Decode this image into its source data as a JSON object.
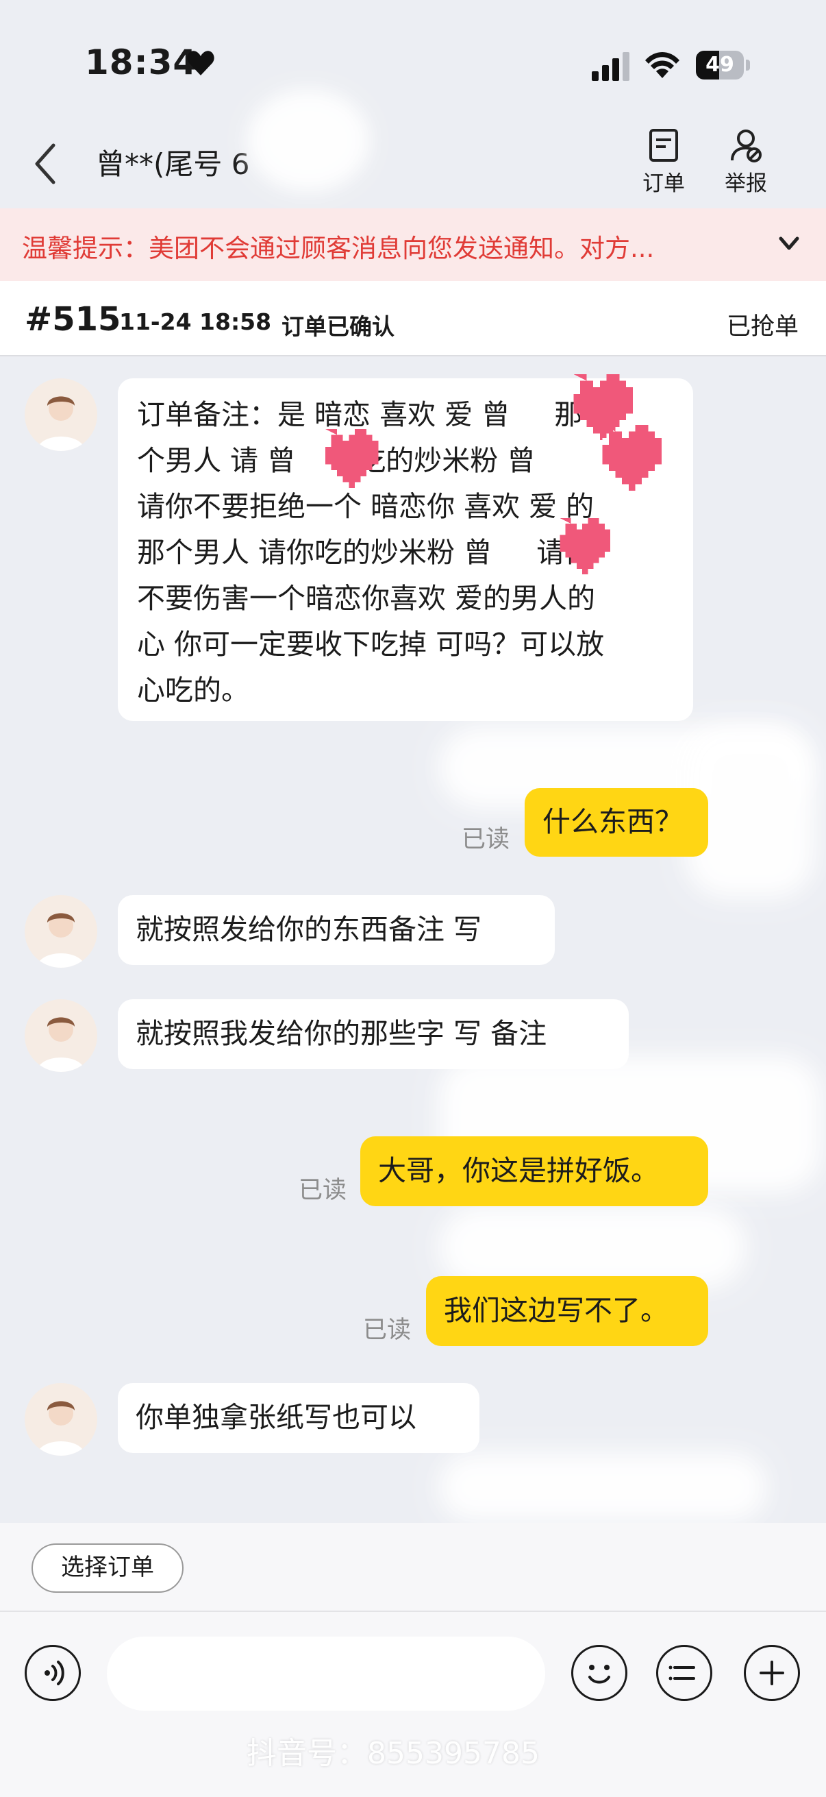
{
  "status_bar": {
    "time": "18:34",
    "battery": "49"
  },
  "nav": {
    "contact_name": "曾**(尾号 6",
    "order_label": "订单",
    "report_label": "举报"
  },
  "warning": {
    "text": "温馨提示：美团不会通过顾客消息向您发送通知。对方..."
  },
  "order": {
    "number": "#515",
    "time": "11-24 18:58",
    "status": "订单已确认",
    "grab_status": "已抢单"
  },
  "messages": [
    {
      "from": "customer",
      "text": "订单备注：是 暗恋 喜欢 爱 曾     那\n个男人 请 曾       吃的炒米粉 曾\n请你不要拒绝一个 暗恋你 喜欢 爱 的\n那个男人 请你吃的炒米粉 曾     请你\n不要伤害一个暗恋你喜欢 爱的男人的\n心 你可一定要收下吃掉 可吗？可以放\n心吃的。"
    },
    {
      "from": "rider",
      "text": "什么东西？",
      "read": "已读"
    },
    {
      "from": "customer",
      "text": "就按照发给你的东西备注 写"
    },
    {
      "from": "customer",
      "text": "就按照我发给你的那些字 写 备注"
    },
    {
      "from": "rider",
      "text": "大哥，你这是拼好饭。",
      "read": "已读"
    },
    {
      "from": "rider",
      "text": "我们这边写不了。",
      "read": "已读"
    },
    {
      "from": "customer",
      "text": "你单独拿张纸写也可以"
    }
  ],
  "footer": {
    "select_order_label": "选择订单",
    "watermark": "抖音号：855395785"
  },
  "icons": [
    "heart-icon",
    "signal-icon",
    "wifi-icon",
    "back-icon",
    "order-icon",
    "report-icon",
    "chevron-down-icon",
    "voice-icon",
    "emoji-icon",
    "list-icon",
    "plus-icon",
    "pixel-heart-icon"
  ],
  "colors": {
    "warning_text": "#e03b36",
    "warning_bg": "#fbe9e9",
    "outgoing_bubble": "#ffd614",
    "chat_bg": "#eceef3"
  }
}
